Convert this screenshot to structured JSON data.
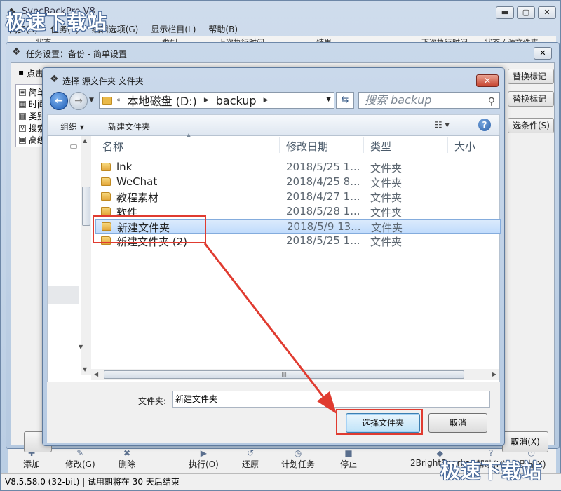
{
  "app": {
    "title": "SyncBackPro V8",
    "menu": [
      "同步(S)",
      "任务(T)",
      "编辑选项(G)",
      "显示栏目(L)",
      "帮助(B)"
    ],
    "col_headers": [
      "状态",
      "类型",
      "上次执行时间",
      "结果",
      "下次执行时间",
      "状态 / 源文件夹"
    ],
    "window_buttons": [
      "minimize-icon",
      "maximize-icon",
      "close-icon"
    ]
  },
  "watermark": "极速下载站",
  "task_dialog": {
    "title": "任务设置：备份 - 简单设置",
    "click_hint": "点击",
    "tree": [
      "简单",
      "时间",
      "类别",
      "搜索",
      "高级"
    ],
    "right_buttons": [
      "替换标记",
      "替换标记",
      "选条件(S)"
    ],
    "cancel_label": "取消(X)"
  },
  "picker": {
    "title": "选择 源文件夹 文件夹",
    "address": [
      "本地磁盘 (D:)",
      "backup"
    ],
    "search_placeholder": "搜索 backup",
    "cmd_organize": "组织 ▾",
    "cmd_new_folder": "新建文件夹",
    "columns": [
      "名称",
      "修改日期",
      "类型",
      "大小"
    ],
    "rows": [
      {
        "name": "lnk",
        "date": "2018/5/25 1...",
        "type": "文件夹",
        "selected": false
      },
      {
        "name": "WeChat",
        "date": "2018/4/25 8...",
        "type": "文件夹",
        "selected": false
      },
      {
        "name": "教程素材",
        "date": "2018/4/27 1...",
        "type": "文件夹",
        "selected": false
      },
      {
        "name": "软件",
        "date": "2018/5/28 1...",
        "type": "文件夹",
        "selected": false
      },
      {
        "name": "新建文件夹",
        "date": "2018/5/9 13...",
        "type": "文件夹",
        "selected": true
      },
      {
        "name": "新建文件夹 (2)",
        "date": "2018/5/25 1...",
        "type": "文件夹",
        "selected": false
      }
    ],
    "folder_label": "文件夹:",
    "folder_value": "新建文件夹",
    "select_button": "选择文件夹",
    "cancel_button": "取消"
  },
  "toolbar": [
    "添加",
    "修改(G)",
    "删除",
    "执行(O)",
    "还原",
    "计划任务",
    "停止",
    "2BrightSparks",
    "帮助(H)",
    "退出(X)"
  ],
  "status": "V8.5.58.0 (32-bit) | 试用期将在 30 天后结束",
  "colors": {
    "highlight": "#e03b30",
    "selection": "#c1dcfc",
    "accent": "#1b5bb5"
  }
}
